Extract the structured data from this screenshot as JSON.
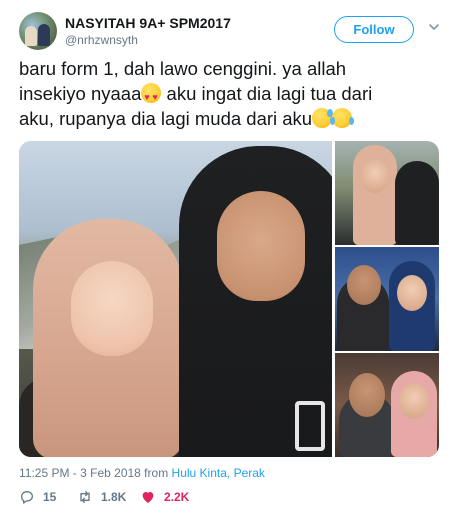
{
  "user": {
    "display_name": "NASYITAH 9A+ SPM2017",
    "handle": "@nrhzwnsyth",
    "follow_label": "Follow"
  },
  "tweet": {
    "line1": "baru form 1, dah lawo cengginі. ya allah",
    "line2_before": "insekiyo nyaaa",
    "line2_after": " aku ingat dia lagi tua dari",
    "line3": "aku, rupanya dia lagi muda dari aku",
    "emojis": [
      "heart-eyes-emoji",
      "sweat-smile-emoji",
      "joy-emoji"
    ]
  },
  "meta": {
    "timestamp": "11:25 PM - 3 Feb 2018 from ",
    "location": "Hulu Kinta, Perak"
  },
  "actions": {
    "replies": "15",
    "retweets": "1.8K",
    "likes": "2.2K"
  },
  "colors": {
    "accent": "#1da1f2",
    "like": "#e0245e",
    "secondary_text": "#657786",
    "primary_text": "#14171a"
  }
}
